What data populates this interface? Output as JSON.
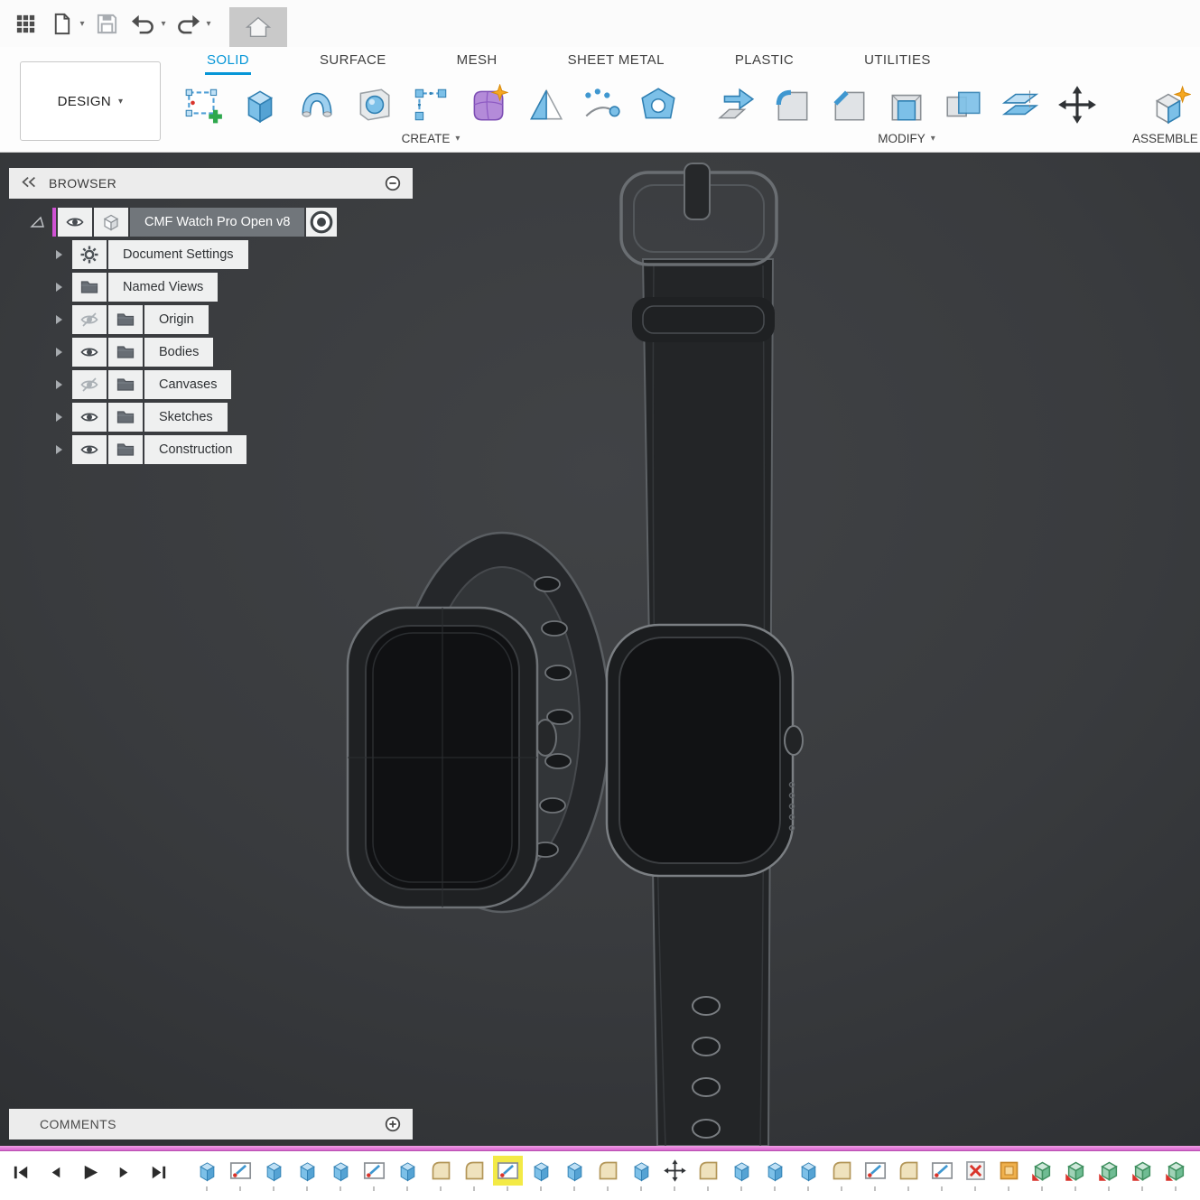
{
  "colors": {
    "accent": "#0696d7",
    "selection_pink": "#cf52d3",
    "highlight_yellow": "#f3ea46"
  },
  "qat": {
    "buttons": [
      {
        "icon": "app-grid"
      },
      {
        "icon": "file-new",
        "caret": true
      },
      {
        "icon": "save"
      },
      {
        "icon": "undo",
        "caret": true
      },
      {
        "icon": "redo",
        "caret": true
      }
    ],
    "home_tab_icon": "home"
  },
  "design_button": {
    "label": "DESIGN"
  },
  "tabs": [
    {
      "label": "SOLID",
      "active": true
    },
    {
      "label": "SURFACE"
    },
    {
      "label": "MESH"
    },
    {
      "label": "SHEET METAL"
    },
    {
      "label": "PLASTIC"
    },
    {
      "label": "UTILITIES"
    }
  ],
  "ribbon_groups": [
    {
      "label": "CREATE",
      "tools": [
        "create-sketch",
        "extrude",
        "revolve",
        "cylinder",
        "pattern",
        "form",
        "draft",
        "project",
        "boundary-fill"
      ]
    },
    {
      "label": "MODIFY",
      "tools": [
        "press-pull",
        "fillet",
        "chamfer",
        "shell",
        "combine",
        "offset-face",
        "move"
      ]
    },
    {
      "label": "ASSEMBLE",
      "tools": [
        "new-component"
      ]
    }
  ],
  "browser": {
    "title": "BROWSER",
    "items": [
      {
        "label": "CMF Watch Pro Open v8",
        "icon": "component",
        "eye": "on",
        "selected": true,
        "radio": true,
        "root": true
      },
      {
        "label": "Document Settings",
        "icon": "gear"
      },
      {
        "label": "Named Views",
        "icon": "folder"
      },
      {
        "label": "Origin",
        "icon": "folder",
        "eye": "off"
      },
      {
        "label": "Bodies",
        "icon": "folder",
        "eye": "on"
      },
      {
        "label": "Canvases",
        "icon": "folder",
        "eye": "off"
      },
      {
        "label": "Sketches",
        "icon": "folder",
        "eye": "on"
      },
      {
        "label": "Construction",
        "icon": "folder",
        "eye": "on"
      }
    ]
  },
  "comments": {
    "label": "COMMENTS"
  },
  "timeline": {
    "playback": [
      "skip-start",
      "step-back",
      "play",
      "step-forward",
      "skip-end"
    ],
    "items": [
      {
        "type": "extrude"
      },
      {
        "type": "sketch"
      },
      {
        "type": "extrude"
      },
      {
        "type": "extrude"
      },
      {
        "type": "extrude"
      },
      {
        "type": "sketch"
      },
      {
        "type": "extrude"
      },
      {
        "type": "fillet"
      },
      {
        "type": "fillet"
      },
      {
        "type": "sketch",
        "highlighted": true
      },
      {
        "type": "extrude"
      },
      {
        "type": "extrude"
      },
      {
        "type": "fillet"
      },
      {
        "type": "extrude"
      },
      {
        "type": "move"
      },
      {
        "type": "fillet"
      },
      {
        "type": "extrude"
      },
      {
        "type": "extrude"
      },
      {
        "type": "extrude"
      },
      {
        "type": "fillet"
      },
      {
        "type": "sketch"
      },
      {
        "type": "fillet"
      },
      {
        "type": "sketch"
      },
      {
        "type": "error"
      },
      {
        "type": "suppressed"
      },
      {
        "type": "component"
      },
      {
        "type": "component"
      },
      {
        "type": "component"
      },
      {
        "type": "component"
      },
      {
        "type": "component"
      }
    ]
  }
}
